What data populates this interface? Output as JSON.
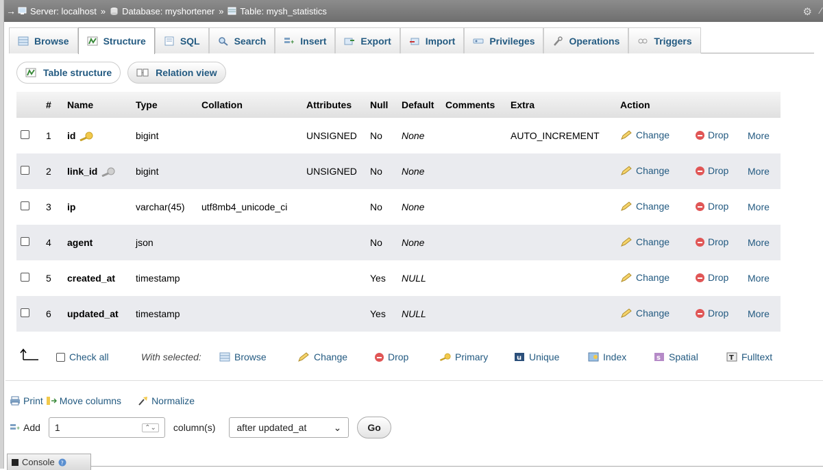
{
  "breadcrumb": {
    "server": "Server: localhost",
    "database": "Database: myshortener",
    "table": "Table: mysh_statistics",
    "separator": "»"
  },
  "tabs": [
    {
      "label": "Browse",
      "icon": "browse-icon"
    },
    {
      "label": "Structure",
      "icon": "structure-icon",
      "active": true
    },
    {
      "label": "SQL",
      "icon": "sql-icon"
    },
    {
      "label": "Search",
      "icon": "search-icon"
    },
    {
      "label": "Insert",
      "icon": "insert-icon"
    },
    {
      "label": "Export",
      "icon": "export-icon"
    },
    {
      "label": "Import",
      "icon": "import-icon"
    },
    {
      "label": "Privileges",
      "icon": "privileges-icon"
    },
    {
      "label": "Operations",
      "icon": "operations-icon"
    },
    {
      "label": "Triggers",
      "icon": "triggers-icon"
    }
  ],
  "subtabs": {
    "table_structure": "Table structure",
    "relation_view": "Relation view"
  },
  "columns_header": {
    "num": "#",
    "name": "Name",
    "type": "Type",
    "collation": "Collation",
    "attributes": "Attributes",
    "null": "Null",
    "default": "Default",
    "comments": "Comments",
    "extra": "Extra",
    "action": "Action"
  },
  "rows": [
    {
      "num": "1",
      "name": "id",
      "type": "bigint",
      "collation": "",
      "attributes": "UNSIGNED",
      "null": "No",
      "default": "None",
      "extra": "AUTO_INCREMENT",
      "key": "primary"
    },
    {
      "num": "2",
      "name": "link_id",
      "type": "bigint",
      "collation": "",
      "attributes": "UNSIGNED",
      "null": "No",
      "default": "None",
      "extra": "",
      "key": "index"
    },
    {
      "num": "3",
      "name": "ip",
      "type": "varchar(45)",
      "collation": "utf8mb4_unicode_ci",
      "attributes": "",
      "null": "No",
      "default": "None",
      "extra": ""
    },
    {
      "num": "4",
      "name": "agent",
      "type": "json",
      "collation": "",
      "attributes": "",
      "null": "No",
      "default": "None",
      "extra": ""
    },
    {
      "num": "5",
      "name": "created_at",
      "type": "timestamp",
      "collation": "",
      "attributes": "",
      "null": "Yes",
      "default": "NULL",
      "extra": ""
    },
    {
      "num": "6",
      "name": "updated_at",
      "type": "timestamp",
      "collation": "",
      "attributes": "",
      "null": "Yes",
      "default": "NULL",
      "extra": ""
    }
  ],
  "row_actions": {
    "change": "Change",
    "drop": "Drop",
    "more": "More"
  },
  "bulk": {
    "check_all": "Check all",
    "with_selected": "With selected:",
    "browse": "Browse",
    "change": "Change",
    "drop": "Drop",
    "primary": "Primary",
    "unique": "Unique",
    "index": "Index",
    "spatial": "Spatial",
    "fulltext": "Fulltext"
  },
  "tools": {
    "print": "Print",
    "move_columns": "Move columns",
    "normalize": "Normalize"
  },
  "add_columns": {
    "label": "Add",
    "count": "1",
    "unit": "column(s)",
    "position": "after updated_at",
    "go": "Go"
  },
  "console": {
    "label": "Console"
  },
  "colors": {
    "link": "#235a81",
    "topbar": "#7a7a7a",
    "row_alt": "#eaebef",
    "drop": "#e05656"
  }
}
